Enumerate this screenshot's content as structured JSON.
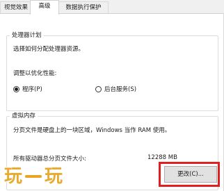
{
  "tabs": [
    {
      "label": "视觉效果",
      "active": false
    },
    {
      "label": "高级",
      "active": true
    },
    {
      "label": "数据执行保护",
      "active": false
    }
  ],
  "processor_scheduling": {
    "title": "处理器计划",
    "description": "选择如何分配处理器资源。",
    "adjust_label": "调整以优化性能:",
    "options": [
      {
        "label": "程序(P)",
        "selected": true
      },
      {
        "label": "后台服务(S)",
        "selected": false
      }
    ]
  },
  "virtual_memory": {
    "title": "虚拟内存",
    "description": "分页文件是硬盘上的一块区域，Windows 当作 RAM 使用。",
    "total_label": "所有驱动器总分页文件大小:",
    "total_value": "12288 MB",
    "change_button": "更改(C)..."
  },
  "watermark": {
    "text": "玩一玩",
    "color": "#e8a623"
  },
  "colors": {
    "highlight": "#e02020",
    "panel_bg": "#ffffff",
    "window_bg": "#f0f0f0"
  }
}
